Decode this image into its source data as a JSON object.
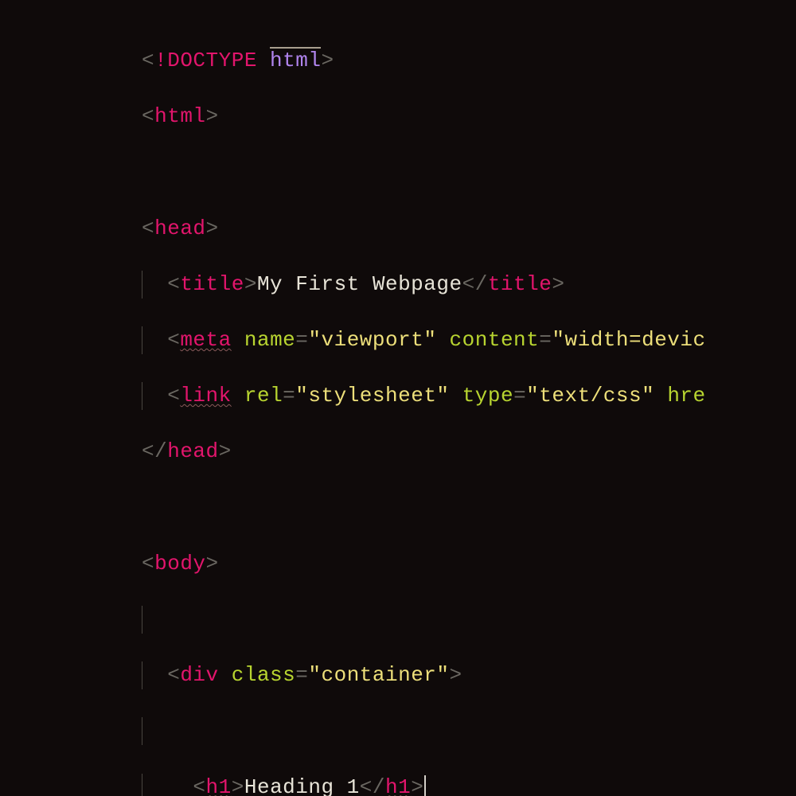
{
  "code": {
    "doctype": {
      "bang": "!",
      "name": "DOCTYPE",
      "value": "html"
    },
    "html_open": "html",
    "head_open": "head",
    "title": {
      "tag": "title",
      "text": "My First Webpage"
    },
    "meta": {
      "tag": "meta",
      "attr1": "name",
      "val1": "viewport",
      "attr2": "content",
      "val2_partial": "width=devic"
    },
    "link": {
      "tag": "link",
      "attr1": "rel",
      "val1": "stylesheet",
      "attr2": "type",
      "val2": "text/css",
      "attr3_partial": "hre"
    },
    "head_close": "head",
    "body_open": "body",
    "div": {
      "tag": "div",
      "attr": "class",
      "val": "container"
    },
    "h1": {
      "tag": "h1",
      "text": "Heading 1"
    }
  },
  "syntax": {
    "lt": "<",
    "gt": ">",
    "slash": "/",
    "eq": "=",
    "quote": "\""
  }
}
